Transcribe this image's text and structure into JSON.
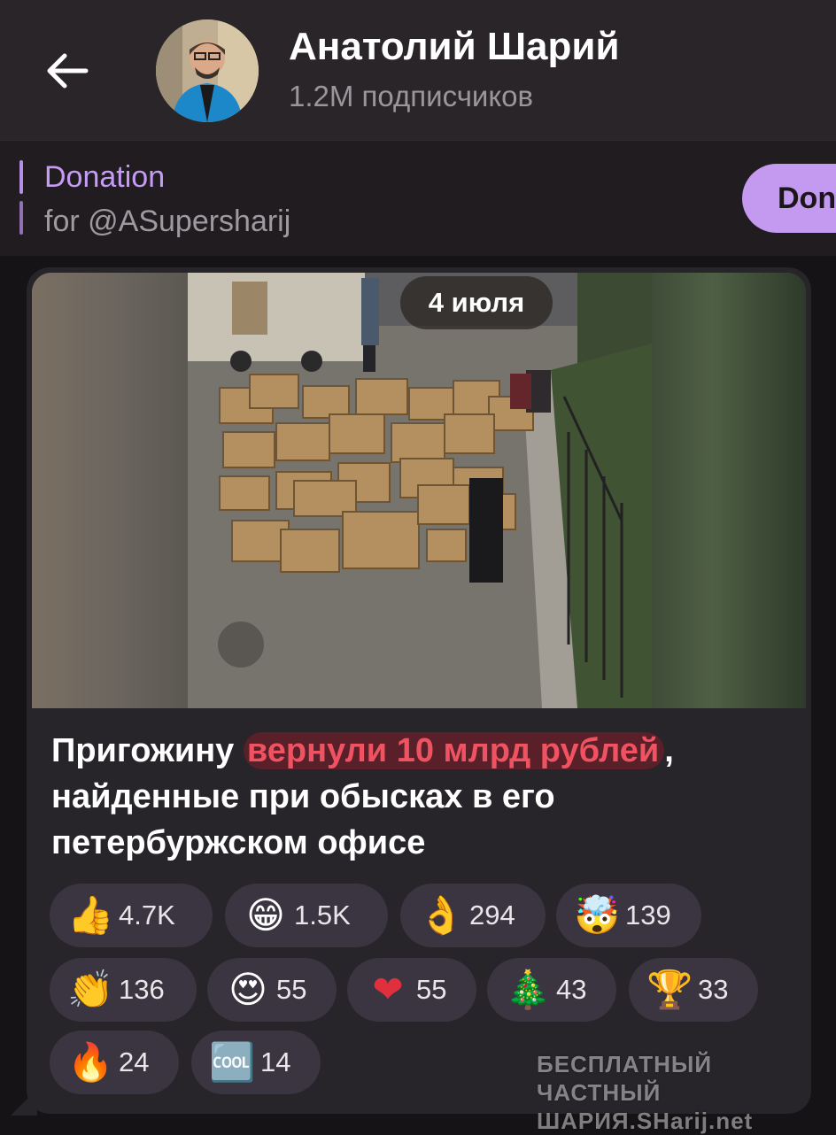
{
  "header": {
    "channel_name": "Анатолий Шарий",
    "subscribers": "1.2M подписчиков",
    "back_icon": "arrow-left-icon"
  },
  "pinned": {
    "title": "Donation",
    "text": "for @ASupersharij",
    "button_label": "Don"
  },
  "message": {
    "date_label": "4 июля",
    "caption_before": "Пригожину ",
    "caption_highlight": "вернули 10 млрд рублей",
    "caption_after": ", найденные при обысках в его петербуржском офисе",
    "reactions": [
      {
        "emoji": "👍",
        "icon": "thumbs-up-icon",
        "count": "4.7K"
      },
      {
        "emoji": "😁",
        "icon": "grinning-face-icon",
        "count": "1.5K"
      },
      {
        "emoji": "👌",
        "icon": "ok-hand-icon",
        "count": "294"
      },
      {
        "emoji": "🤯",
        "icon": "exploding-head-icon",
        "count": "139"
      },
      {
        "emoji": "👏",
        "icon": "clapping-hands-icon",
        "count": "136"
      },
      {
        "emoji": "😍",
        "icon": "heart-eyes-icon",
        "count": "55"
      },
      {
        "emoji": "❤",
        "icon": "heart-icon",
        "count": "55"
      },
      {
        "emoji": "🎄",
        "icon": "christmas-tree-icon",
        "count": "43"
      },
      {
        "emoji": "🏆",
        "icon": "trophy-icon",
        "count": "33"
      },
      {
        "emoji": "🔥",
        "icon": "fire-icon",
        "count": "24"
      },
      {
        "emoji": "🆒",
        "icon": "cool-icon",
        "count": "14"
      }
    ]
  },
  "watermark": {
    "line1": "БЕСПЛАТНЫЙ ЧАСТНЫЙ",
    "line2": "ШАРИЯ.SHarij.net"
  }
}
